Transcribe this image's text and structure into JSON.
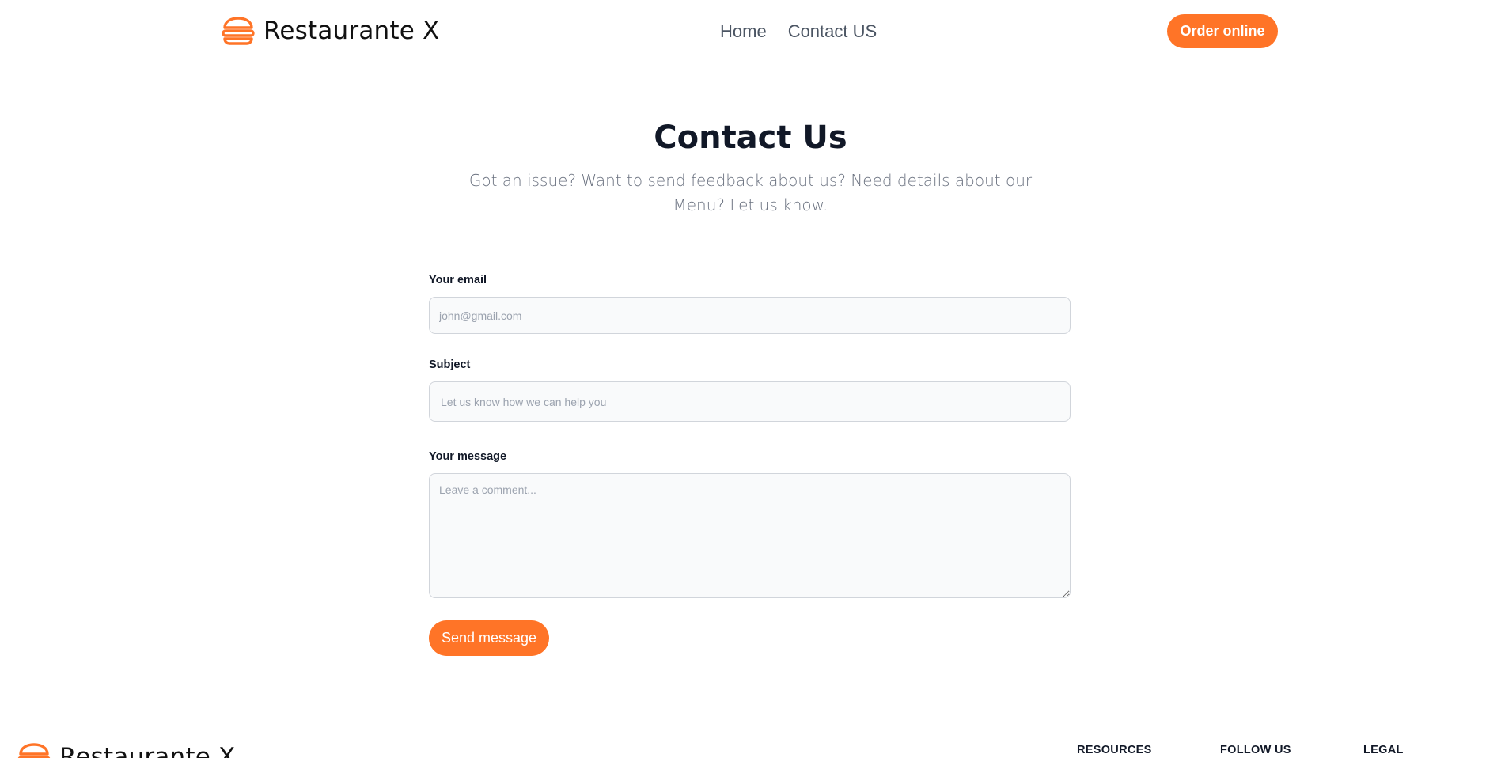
{
  "brand": {
    "name": "Restaurante X",
    "logo_icon": "burger-icon",
    "accent_color": "#ff7427"
  },
  "nav": {
    "items": [
      {
        "label": "Home"
      },
      {
        "label": "Contact US"
      }
    ],
    "order_button_label": "Order online"
  },
  "hero": {
    "title": "Contact Us",
    "subtitle": "Got an issue? Want to send feedback about us? Need details about our Menu? Let us know."
  },
  "form": {
    "email": {
      "label": "Your email",
      "placeholder": "john@gmail.com",
      "value": ""
    },
    "subject": {
      "label": "Subject",
      "placeholder": "Let us know how we can help you",
      "value": ""
    },
    "message": {
      "label": "Your message",
      "placeholder": "Leave a comment...",
      "value": ""
    },
    "submit_label": "Send message"
  },
  "footer": {
    "brand_name": "Restaurante X",
    "headings": [
      "RESOURCES",
      "FOLLOW US",
      "LEGAL"
    ]
  }
}
